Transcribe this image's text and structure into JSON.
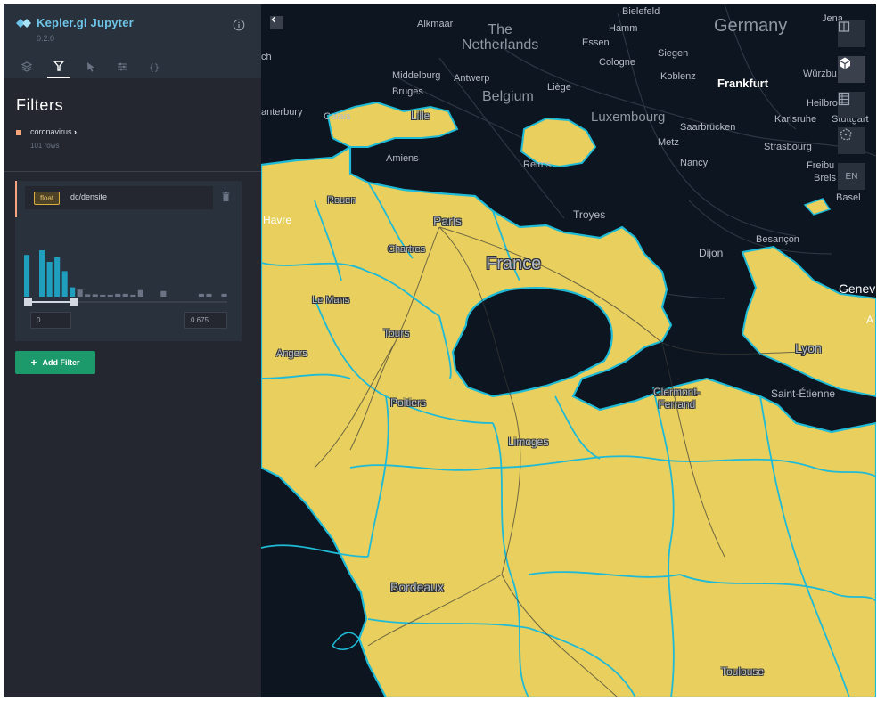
{
  "app": {
    "title": "Kepler.gl Jupyter",
    "version": "0.2.0"
  },
  "sidebar": {
    "tabs": [
      {
        "name": "layers",
        "icon": "layers-icon"
      },
      {
        "name": "filters",
        "icon": "filter-icon",
        "active": true
      },
      {
        "name": "interactions",
        "icon": "cursor-icon"
      },
      {
        "name": "base-map",
        "icon": "sliders-icon"
      },
      {
        "name": "config",
        "icon": "braces-icon"
      }
    ]
  },
  "filters_panel": {
    "title": "Filters",
    "dataset": {
      "name": "coronavirus",
      "rows": "101 rows",
      "color": "#f7a37e"
    },
    "filter": {
      "type": "float",
      "field": "dc/densite",
      "range_min": "0",
      "range_max": "0.675",
      "slider_value": [
        0,
        0.675
      ],
      "histogram": [
        0.9,
        0.0,
        1.0,
        0.75,
        0.85,
        0.55,
        0.2,
        0.15,
        0.05,
        0.05,
        0.04,
        0.04,
        0.06,
        0.06,
        0.04,
        0.14,
        0,
        0,
        0.12,
        0,
        0,
        0,
        0,
        0.06,
        0.06,
        0,
        0.06
      ]
    },
    "add_filter_label": "Add Filter"
  },
  "map": {
    "fill_color": "#e8cf5e",
    "border_color": "#1fbad6",
    "controls": [
      {
        "name": "split-map",
        "icon": "split-icon"
      },
      {
        "name": "3d-map",
        "icon": "cube-icon",
        "active": true
      },
      {
        "name": "legend",
        "icon": "legend-icon"
      },
      {
        "name": "draw",
        "icon": "polygon-icon"
      },
      {
        "name": "language",
        "label": "EN"
      }
    ],
    "labels": {
      "bielefeld": "Bielefeld",
      "the_netherlands": "The\nNetherlands",
      "germany": "Germany",
      "jena": "Jena",
      "alkmaar": "Alkmaar",
      "hamm": "Hamm",
      "essen": "Essen",
      "siegen": "Siegen",
      "cologne": "Cologne",
      "middelburg": "Middelburg",
      "antwerp": "Antwerp",
      "koblenz": "Koblenz",
      "wurzbu": "Würzbu",
      "frankfurt": "Frankfurt",
      "bruges": "Bruges",
      "liege": "Liège",
      "belgium": "Belgium",
      "heilbr": "Heilbro",
      "canterbury": "anterbury",
      "calais": "Calais",
      "lille": "Lille",
      "luxembourg": "Luxembourg",
      "karlsruhe": "Karlsruhe",
      "stuttgart": "Stuttgart",
      "saarbrucken": "Saarbrücken",
      "metz": "Metz",
      "strasbourg": "Strasbourg",
      "amiens": "Amiens",
      "reims": "Reims",
      "nancy": "Nancy",
      "freibu": "Freibu",
      "breis": "Breis",
      "basel": "Basel",
      "rouen": "Rouen",
      "havre": "Havre",
      "paris": "Paris",
      "troyes": "Troyes",
      "besancon": "Besançon",
      "chartres": "Chartres",
      "france": "France",
      "dijon": "Dijon",
      "geneva": "Genev",
      "le_mans": "Le Mans",
      "tours": "Tours",
      "lyon": "Lyon",
      "angers": "Angers",
      "clermont": "Clermont-\nFerrand",
      "saint_etienne": "Saint-Étienne",
      "poitiers": "Poitiers",
      "limoges": "Limoges",
      "bordeaux": "Bordeaux",
      "toulouse": "Toulouse",
      "ch": "ch",
      "a": "A"
    }
  }
}
